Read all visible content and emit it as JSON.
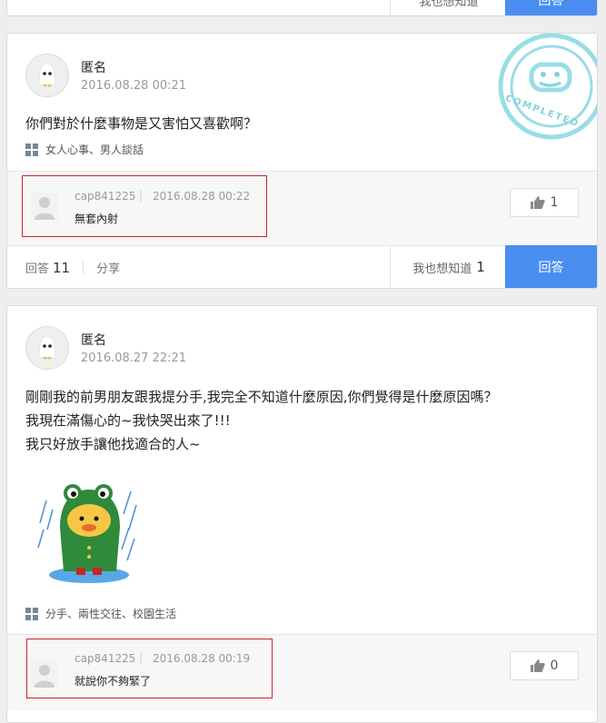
{
  "top_partial": {
    "want_label": "我也想知道",
    "answer_label": "回答"
  },
  "posts": [
    {
      "author": "匿名",
      "date": "2016.08.28 00:21",
      "question_lines": [
        "你們對於什麼事物是又害怕又喜歡啊？"
      ],
      "tags": "女人心事、男人談話",
      "stamp_text": "COMPLETED",
      "answer": {
        "user": "cap841225",
        "separator": "|",
        "date": "2016.08.28 00:22",
        "text": "無套內射",
        "likes": "1"
      },
      "footer": {
        "answers_label": "回答",
        "answers_count": "11",
        "share_label": "分享",
        "want_label": "我也想知道",
        "want_count": "1",
        "answer_button": "回答"
      }
    },
    {
      "author": "匿名",
      "date": "2016.08.27 22:21",
      "question_lines": [
        "剛剛我的前男朋友跟我提分手,我完全不知道什麼原因,你們覺得是什麼原因嗎？",
        "我現在滿傷心的~我快哭出來了!!!",
        "我只好放手讓他找適合的人~"
      ],
      "tags": "分手、兩性交往、校園生活",
      "answer": {
        "user": "cap841225",
        "separator": "|",
        "date": "2016.08.28 00:19",
        "text": "就說你不夠緊了",
        "likes": "0"
      }
    }
  ],
  "colors": {
    "accent": "#4a8df0",
    "highlight": "#c9252b",
    "stamp": "#7fd4e0"
  }
}
